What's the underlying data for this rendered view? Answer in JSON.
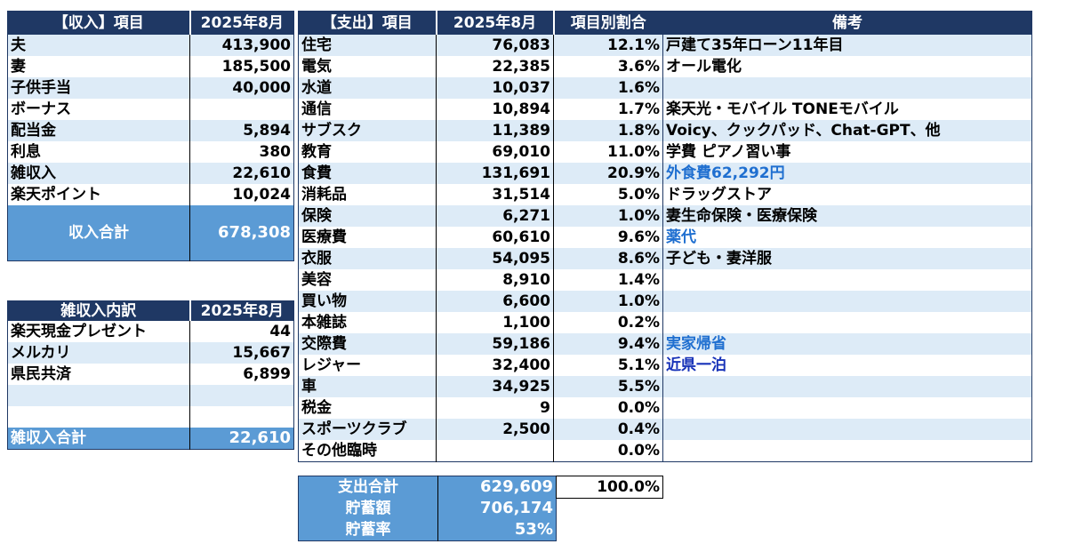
{
  "income": {
    "header_label": "【収入】項目",
    "header_month": "2025年8月",
    "rows": [
      {
        "label": "夫",
        "value": "413,900"
      },
      {
        "label": "妻",
        "value": "185,500"
      },
      {
        "label": "子供手当",
        "value": "40,000"
      },
      {
        "label": "ボーナス",
        "value": ""
      },
      {
        "label": "配当金",
        "value": "5,894"
      },
      {
        "label": "利息",
        "value": "380"
      },
      {
        "label": "雑収入",
        "value": "22,610"
      },
      {
        "label": "楽天ポイント",
        "value": "10,024"
      }
    ],
    "total_label": "収入合計",
    "total_value": "678,308"
  },
  "misc_income": {
    "header_label": "雑収入内訳",
    "header_month": "2025年8月",
    "rows": [
      {
        "label": "楽天現金プレゼント",
        "value": "44"
      },
      {
        "label": "メルカリ",
        "value": "15,667"
      },
      {
        "label": "県民共済",
        "value": "6,899"
      },
      {
        "label": "",
        "value": ""
      },
      {
        "label": "",
        "value": ""
      }
    ],
    "total_label": "雑収入合計",
    "total_value": "22,610"
  },
  "expense": {
    "header_label": "【支出】項目",
    "header_month": "2025年8月",
    "header_ratio": "項目別割合",
    "header_note": "備考",
    "rows": [
      {
        "label": "住宅",
        "value": "76,083",
        "ratio": "12.1%",
        "note": "戸建て35年ローン11年目"
      },
      {
        "label": "電気",
        "value": "22,385",
        "ratio": "3.6%",
        "note": "オール電化"
      },
      {
        "label": "水道",
        "value": "10,037",
        "ratio": "1.6%",
        "note": ""
      },
      {
        "label": "通信",
        "value": "10,894",
        "ratio": "1.7%",
        "note": "楽天光・モバイル TONEモバイル"
      },
      {
        "label": "サブスク",
        "value": "11,389",
        "ratio": "1.8%",
        "note": "Voicy、クックパッド、Chat-GPT、他"
      },
      {
        "label": "教育",
        "value": "69,010",
        "ratio": "11.0%",
        "note": "学費 ピアノ習い事"
      },
      {
        "label": "食費",
        "value": "131,691",
        "ratio": "20.9%",
        "note": "外食費62,292円"
      },
      {
        "label": "消耗品",
        "value": "31,514",
        "ratio": "5.0%",
        "note": "ドラッグストア"
      },
      {
        "label": "保険",
        "value": "6,271",
        "ratio": "1.0%",
        "note": "妻生命保険・医療保険"
      },
      {
        "label": "医療費",
        "value": "60,610",
        "ratio": "9.6%",
        "note": "薬代"
      },
      {
        "label": "衣服",
        "value": "54,095",
        "ratio": "8.6%",
        "note": "子ども・妻洋服"
      },
      {
        "label": "美容",
        "value": "8,910",
        "ratio": "1.4%",
        "note": ""
      },
      {
        "label": "買い物",
        "value": "6,600",
        "ratio": "1.0%",
        "note": ""
      },
      {
        "label": "本雑誌",
        "value": "1,100",
        "ratio": "0.2%",
        "note": ""
      },
      {
        "label": "交際費",
        "value": "59,186",
        "ratio": "9.4%",
        "note": "実家帰省"
      },
      {
        "label": "レジャー",
        "value": "32,400",
        "ratio": "5.1%",
        "note": "近県一泊"
      },
      {
        "label": "車",
        "value": "34,925",
        "ratio": "5.5%",
        "note": ""
      },
      {
        "label": "税金",
        "value": "9",
        "ratio": "0.0%",
        "note": ""
      },
      {
        "label": "スポーツクラブ",
        "value": "2,500",
        "ratio": "0.4%",
        "note": ""
      },
      {
        "label": "その他臨時",
        "value": "",
        "ratio": "0.0%",
        "note": ""
      }
    ],
    "total_label": "支出合計",
    "total_value": "629,609",
    "total_ratio": "100.0%",
    "savings_label": "貯蓄額",
    "savings_value": "706,174",
    "savings_rate_label": "貯蓄率",
    "savings_rate_value": "53%"
  },
  "colors": {
    "header_bg": "#1f3864",
    "stripe_bg": "#ddebf7",
    "total_bg": "#5b9bd5",
    "note_blue": "#1f6fd0",
    "note_navy": "#1732b8"
  }
}
